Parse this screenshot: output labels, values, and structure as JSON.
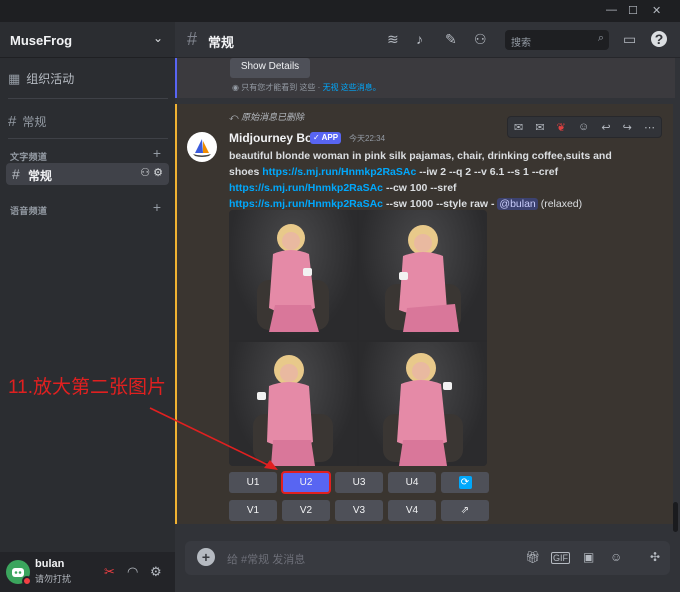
{
  "window": {
    "minimize": "—",
    "maximize": "☐",
    "close": "✕"
  },
  "sidebar": {
    "server_name": "MuseFrog",
    "events_label": "组织活动",
    "channel_general": "常规",
    "cat_text": "文字频道",
    "active_channel": "常规",
    "cat_voice": "语音频道"
  },
  "user": {
    "name": "bulan",
    "status": "请勿打扰"
  },
  "header": {
    "channel": "常规",
    "search_placeholder": "搜索"
  },
  "ephemeral": {
    "button": "Show Details",
    "note_prefix": "只有您才能看到 这些 · ",
    "note_dismiss": "无视 这些消息。"
  },
  "message": {
    "reply_note": "原始消息已删除",
    "author": "Midjourney Bot",
    "badge": "✓ APP",
    "time": "今天22:34",
    "prompt_text": "beautiful blonde woman in pink silk pajamas, chair, drinking coffee,suits and shoes ",
    "link": "https://s.mj.run/Hnmkp2RaSAc",
    "params1": " --iw 2 --q 2 --v 6.1 --s 1 --cref ",
    "params2": " --cw 100 --sref ",
    "params3": " --sw 1000 --style raw - ",
    "mention": "@bulan",
    "relaxed": " (relaxed)"
  },
  "buttons_row1": [
    "U1",
    "U2",
    "U3",
    "U4"
  ],
  "buttons_row2": [
    "V1",
    "V2",
    "V3",
    "V4"
  ],
  "annotation": "11.放大第二张图片",
  "composer": {
    "placeholder": "给 #常规 发消息",
    "gif": "GIF"
  },
  "colors": {
    "accent": "#5865f2",
    "highlight": "#e02020",
    "pink": "#e58aa7"
  }
}
